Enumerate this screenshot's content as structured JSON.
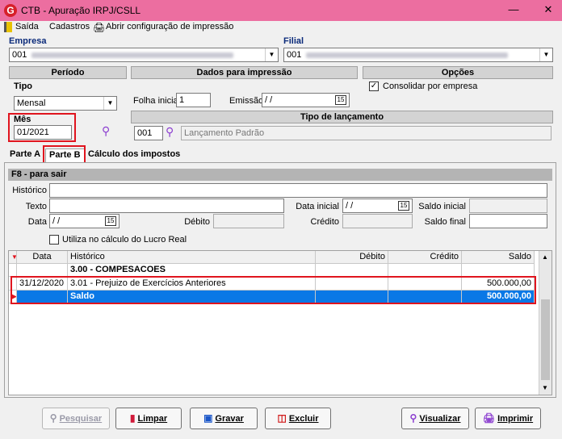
{
  "window": {
    "title": "CTB - Apuração IRPJ/CSLL",
    "logo": "G"
  },
  "menu": {
    "saida": "Saída",
    "cadastros": "Cadastros",
    "config": "Abrir configuração de impressão"
  },
  "empresa": {
    "label": "Empresa",
    "code": "001"
  },
  "filial": {
    "label": "Filial",
    "code": "001"
  },
  "periodo": {
    "title": "Período",
    "tipo_label": "Tipo",
    "tipo_value": "Mensal",
    "mes_label": "Mês",
    "mes_value": "01/2021"
  },
  "dados_impressao": {
    "title": "Dados para impressão",
    "folha_label": "Folha inicial",
    "folha_value": "1",
    "emissao_label": "Emissão",
    "emissao_value": " / /"
  },
  "opcoes": {
    "title": "Opções",
    "consolidar_label": "Consolidar por empresa",
    "consolidar_checked": true
  },
  "tipo_lancamento": {
    "title": "Tipo de lançamento",
    "code": "001",
    "desc": "Lançamento Padrão"
  },
  "tabs": {
    "parte_a": "Parte A",
    "parte_b": "Parte B",
    "calculo": "Cálculo dos impostos"
  },
  "filter": {
    "header": "F8 - para sair",
    "historico_label": "Histórico",
    "texto_label": "Texto",
    "data_label": "Data",
    "data_value": " / /",
    "debito_label": "Débito",
    "data_inicial_label": "Data inicial",
    "data_inicial_value": " / /",
    "credito_label": "Crédito",
    "saldo_inicial_label": "Saldo inicial",
    "saldo_final_label": "Saldo final",
    "lucro_real_label": "Utiliza no cálculo do Lucro Real"
  },
  "grid": {
    "columns": [
      "Data",
      "Histórico",
      "Débito",
      "Crédito",
      "Saldo"
    ],
    "group_row": "3.00 - COMPESACOES",
    "rows": [
      {
        "data": "31/12/2020",
        "historico": "3.01 - Prejuizo de Exercícios Anteriores",
        "debito": "",
        "credito": "",
        "saldo": "500.000,00"
      }
    ],
    "total_row": {
      "historico": "Saldo",
      "saldo": "500.000,00"
    }
  },
  "buttons": {
    "pesquisar": "Pesquisar",
    "limpar": "Limpar",
    "gravar": "Gravar",
    "excluir": "Excluir",
    "visualizar": "Visualizar",
    "imprimir": "Imprimir"
  },
  "colors": {
    "titlebar": "#ec6ea0",
    "selection": "#0a78e6",
    "highlight_red": "#e0141e"
  }
}
